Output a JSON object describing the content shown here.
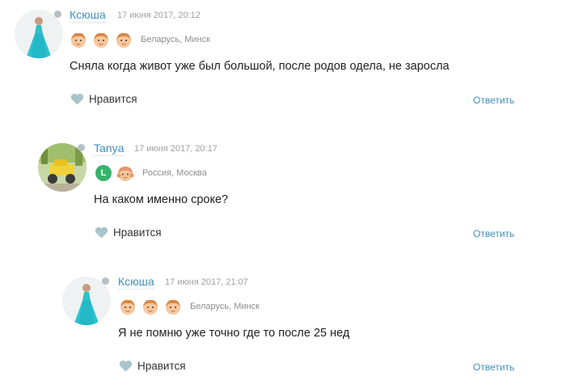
{
  "comments": [
    {
      "name": "Ксюша",
      "date": "17 июня 2017, 20:12",
      "location": "Беларусь, Минск",
      "text": "Сняла когда живот уже был большой, после родов одела, не заросла",
      "like_label": "Нравится",
      "reply_label": "Ответить"
    },
    {
      "name": "Tanya",
      "date": "17 июня 2017, 20:17",
      "badge_letter": "L",
      "location": "Россия, Москва",
      "text": "На каком именно сроке?",
      "like_label": "Нравится",
      "reply_label": "Ответить"
    },
    {
      "name": "Ксюша",
      "date": "17 июня 2017, 21:07",
      "location": "Беларусь, Минск",
      "text": "Я не помню уже точно где то после 25 нед",
      "like_label": "Нравится",
      "reply_label": "Ответить"
    }
  ],
  "colors": {
    "accent": "#3e8fbd",
    "heart": "#a9c4cb",
    "green_badge": "#38b36b",
    "muted": "#a0a0a0"
  },
  "icons": {
    "boy": "boy-child-icon",
    "girl": "girl-child-icon",
    "heart": "heart-icon"
  }
}
